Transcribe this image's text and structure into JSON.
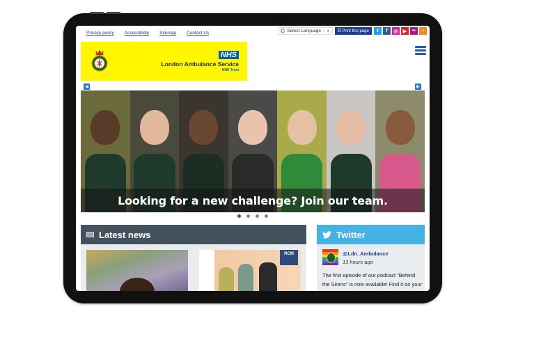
{
  "top_links": [
    "Privacy policy",
    "Accessibility",
    "Sitemap",
    "Contact Us"
  ],
  "language": {
    "icon": "google-g-icon",
    "label": "Select Language",
    "arrow": "▼"
  },
  "print_button": {
    "icon": "printer-icon",
    "label": "Print this page"
  },
  "social_icons": [
    {
      "name": "twitter-icon",
      "glyph": "t",
      "color": "#1da1f2"
    },
    {
      "name": "facebook-icon",
      "glyph": "f",
      "color": "#3b5998"
    },
    {
      "name": "instagram-icon",
      "glyph": "◎",
      "color": "#d6249f"
    },
    {
      "name": "youtube-icon",
      "glyph": "▶",
      "color": "#e62117"
    },
    {
      "name": "flickr-icon",
      "glyph": "••",
      "color": "#b3167a"
    },
    {
      "name": "rss-icon",
      "glyph": "◝",
      "color": "#f78422"
    }
  ],
  "logo": {
    "nhs": "NHS",
    "name": "London Ambulance Service",
    "trust": "NHS Trust",
    "background": "#fff600"
  },
  "hero": {
    "caption": "Looking for a new challenge? Join our team.",
    "prev": "◀",
    "next": "▶",
    "slides": 4,
    "active_slide": 1
  },
  "news": {
    "title": "Latest news",
    "icon": "newspaper-icon"
  },
  "twitter": {
    "title": "Twitter",
    "icon": "twitter-bird-icon",
    "handle": "@Ldn_Ambulance",
    "time": "13 hours ago",
    "text": "The first episode of our podcast \"Behind the Sirens\" is now available! Find it on your usual podcast"
  },
  "colors": {
    "nhs_blue": "#005eb8",
    "print_blue": "#1d3d8f",
    "news_header": "#43525f",
    "twitter_header": "#45b1e5",
    "panel_bg": "#e9edf0"
  }
}
